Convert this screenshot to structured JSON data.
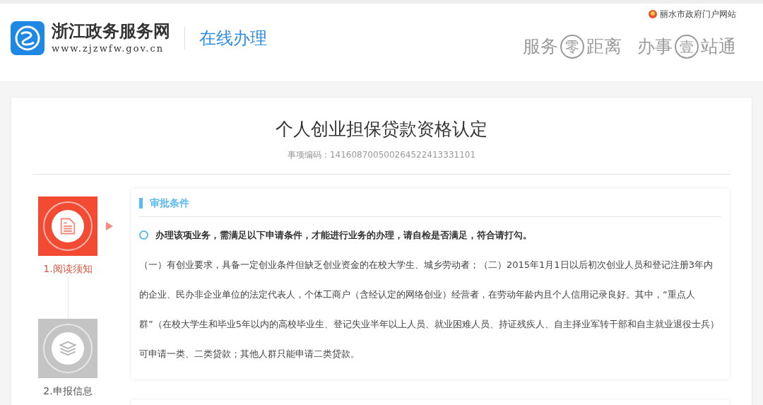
{
  "header": {
    "site_name": "浙江政务服务网",
    "site_url": "www.zjzwfw.gov.cn",
    "section": "在线办理",
    "portal_link": "丽水市政府门户网站",
    "slogan": [
      {
        "kind": "plain",
        "text": "服务"
      },
      {
        "kind": "circled",
        "text": "零"
      },
      {
        "kind": "plain",
        "text": "距离"
      },
      {
        "kind": "gap"
      },
      {
        "kind": "plain",
        "text": "办事"
      },
      {
        "kind": "circled",
        "text": "壹"
      },
      {
        "kind": "plain",
        "text": "站通"
      }
    ]
  },
  "page": {
    "title": "个人创业担保贷款资格认定",
    "item_code": "事项编码：141608700500264522413331101"
  },
  "steps": [
    {
      "kind": "document",
      "label": "1.阅读须知",
      "selected": true
    },
    {
      "kind": "layers",
      "label": "2.申报信息",
      "selected": false
    }
  ],
  "conditions": {
    "heading": "审批条件",
    "notice": "办理该项业务，需满足以下申请条件，才能进行业务的办理，请自检是否满足，符合请打勾。",
    "checked": false,
    "body": "（一）有创业要求，具备一定创业条件但缺乏创业资金的在校大学生、城乡劳动者；（二）2015年1月1日以后初次创业人员和登记注册3年内的企业、民办非企业单位的法定代表人，个体工商户（含经认定的网络创业）经营者，在劳动年龄内且个人信用记录良好。其中，“重点人群”（在校大学生和毕业5年以内的高校毕业生、登记失业半年以上人员、就业困难人员、持证残疾人、自主择业军转干部和自主就业退役士兵）可申请一类、二类贷款；其他人群只能申请二类贷款。"
  }
}
